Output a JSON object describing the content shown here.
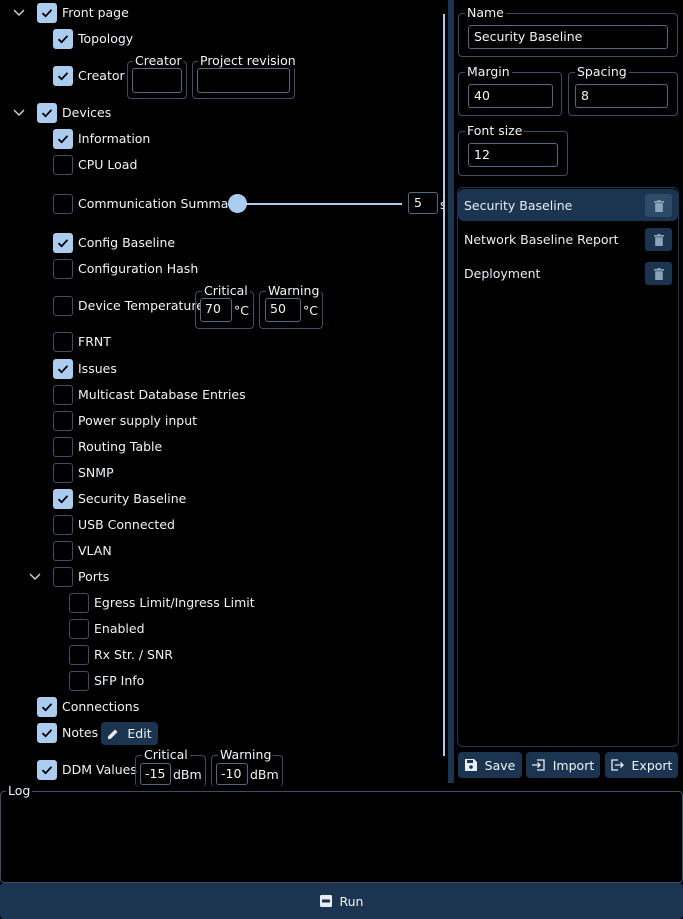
{
  "tree": {
    "front_page": {
      "label": "Front page",
      "checked": true
    },
    "topology": {
      "label": "Topology",
      "checked": true
    },
    "creator": {
      "label": "Creator",
      "checked": true,
      "field_label": "Creator",
      "field_value": "",
      "revision_label": "Project revision",
      "revision_value": ""
    },
    "devices": {
      "label": "Devices",
      "checked": true
    },
    "information": {
      "label": "Information",
      "checked": true
    },
    "cpu_load": {
      "label": "CPU Load",
      "checked": false
    },
    "communication_summary": {
      "label": "Communication Summary",
      "checked": false,
      "slider_value": 5,
      "slider_unit": "s",
      "slider_fraction": 0
    },
    "config_baseline": {
      "label": "Config Baseline",
      "checked": true
    },
    "configuration_hash": {
      "label": "Configuration Hash",
      "checked": false
    },
    "device_temperature": {
      "label": "Device Temperature",
      "checked": false,
      "critical_label": "Critical",
      "critical_value": "70",
      "warning_label": "Warning",
      "warning_value": "50",
      "unit": "°C"
    },
    "frnt": {
      "label": "FRNT",
      "checked": false
    },
    "issues": {
      "label": "Issues",
      "checked": true
    },
    "multicast": {
      "label": "Multicast Database Entries",
      "checked": false
    },
    "power_supply": {
      "label": "Power supply input",
      "checked": false
    },
    "routing_table": {
      "label": "Routing Table",
      "checked": false
    },
    "snmp": {
      "label": "SNMP",
      "checked": false
    },
    "security_baseline": {
      "label": "Security Baseline",
      "checked": true
    },
    "usb_connected": {
      "label": "USB Connected",
      "checked": false
    },
    "vlan": {
      "label": "VLAN",
      "checked": false
    },
    "ports": {
      "label": "Ports",
      "checked": false
    },
    "egress_limit": {
      "label": "Egress Limit/Ingress Limit",
      "checked": false
    },
    "enabled": {
      "label": "Enabled",
      "checked": false
    },
    "rx_str": {
      "label": "Rx Str. / SNR",
      "checked": false
    },
    "sfp_info": {
      "label": "SFP Info",
      "checked": false
    },
    "connections": {
      "label": "Connections",
      "checked": true
    },
    "notes": {
      "label": "Notes",
      "checked": true,
      "edit_label": "Edit"
    },
    "ddm_values": {
      "label": "DDM Values",
      "checked": true,
      "critical_label": "Critical",
      "critical_value": "-15",
      "warning_label": "Warning",
      "warning_value": "-10",
      "unit": "dBm"
    }
  },
  "settings": {
    "name_label": "Name",
    "name_value": "Security Baseline",
    "margin_label": "Margin",
    "margin_value": "40",
    "spacing_label": "Spacing",
    "spacing_value": "8",
    "font_size_label": "Font size",
    "font_size_value": "12"
  },
  "templates": [
    {
      "label": "Security Baseline",
      "selected": true
    },
    {
      "label": "Network Baseline Report",
      "selected": false
    },
    {
      "label": "Deployment",
      "selected": false
    }
  ],
  "actions": {
    "save_label": "Save",
    "import_label": "Import",
    "export_label": "Export"
  },
  "log": {
    "label": "Log",
    "content": ""
  },
  "run": {
    "label": "Run"
  },
  "colors": {
    "accent": "#a9ccef",
    "button_bg": "#1b3550",
    "border": "#3a4f66",
    "splitter": "#1b3550"
  }
}
